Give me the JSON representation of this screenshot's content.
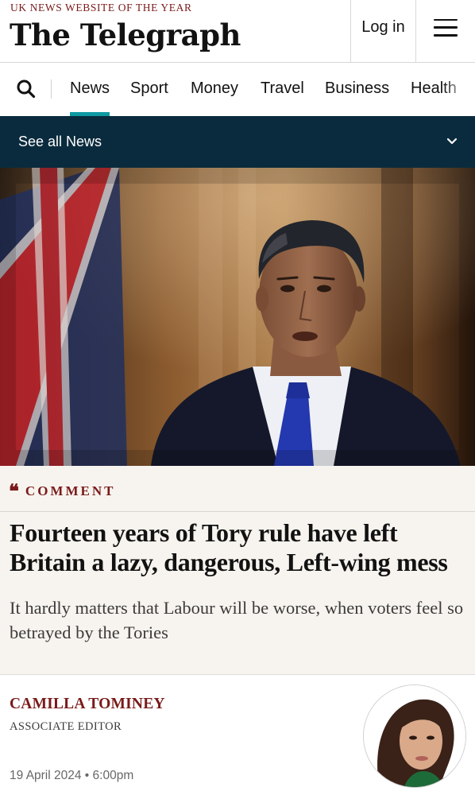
{
  "header": {
    "tagline": "UK NEWS WEBSITE OF THE YEAR",
    "masthead": "The Telegraph",
    "login_label": "Log in"
  },
  "nav": {
    "items": [
      {
        "label": "News",
        "active": true
      },
      {
        "label": "Sport",
        "active": false
      },
      {
        "label": "Money",
        "active": false
      },
      {
        "label": "Travel",
        "active": false
      },
      {
        "label": "Business",
        "active": false
      },
      {
        "label": "Health",
        "active": false
      }
    ],
    "accent": "#0f9aa3"
  },
  "section_bar": {
    "label": "See all News",
    "background": "#0a2b3d"
  },
  "article": {
    "kicker": "COMMENT",
    "headline": "Fourteen years of Tory rule have left Britain a lazy, dangerous, Left-wing mess",
    "standfirst": "It hardly matters that Labour will be worse, when voters feel so betrayed by the Tories",
    "accent": "#7a1a1a"
  },
  "byline": {
    "author": "CAMILLA TOMINEY",
    "role": "ASSOCIATE EDITOR",
    "date": "19 April 2024 • 6:00pm"
  },
  "icons": {
    "search": "search-icon",
    "menu": "hamburger-menu-icon",
    "chevron": "chevron-down-icon",
    "quote": "quote-icon"
  }
}
